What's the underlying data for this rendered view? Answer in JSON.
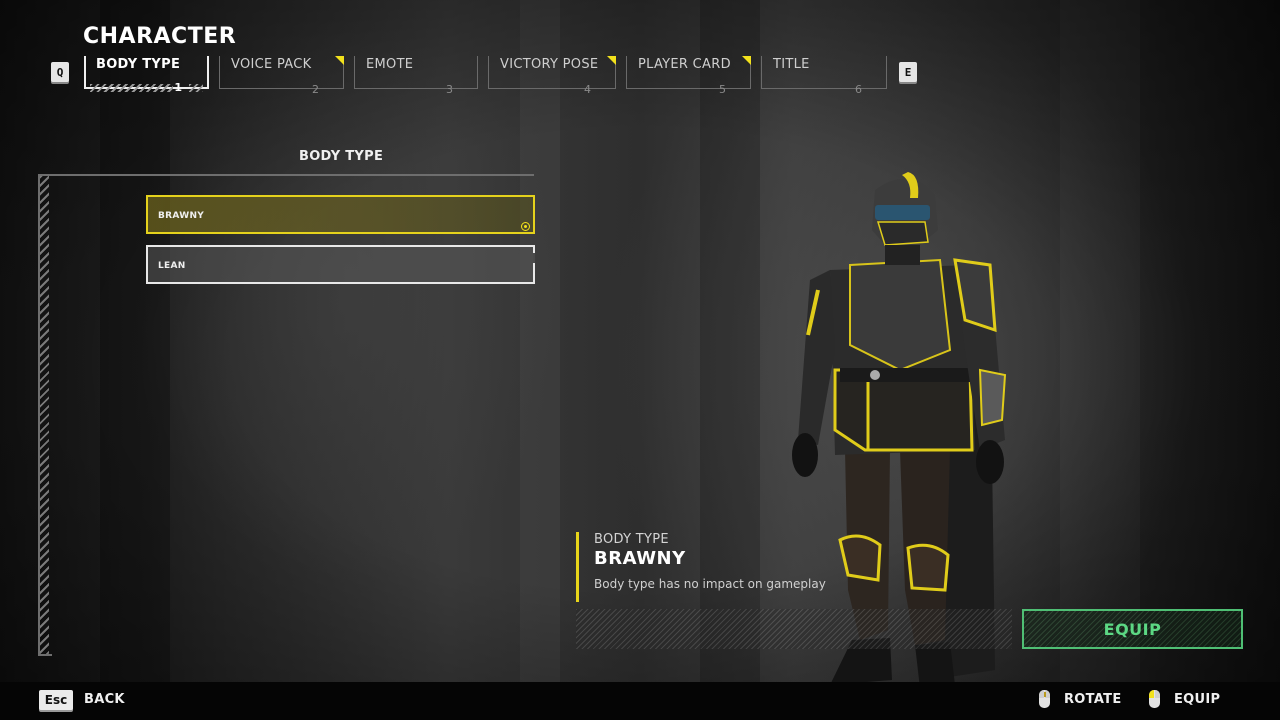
{
  "header": {
    "title": "CHARACTER",
    "prev_key": "Q",
    "next_key": "E"
  },
  "tabs": [
    {
      "label": "BODY TYPE",
      "number": "1",
      "active": true,
      "new_indicator": false
    },
    {
      "label": "VOICE PACK",
      "number": "2",
      "active": false,
      "new_indicator": true
    },
    {
      "label": "EMOTE",
      "number": "3",
      "active": false,
      "new_indicator": false
    },
    {
      "label": "VICTORY POSE",
      "number": "4",
      "active": false,
      "new_indicator": true
    },
    {
      "label": "PLAYER CARD",
      "number": "5",
      "active": false,
      "new_indicator": true
    },
    {
      "label": "TITLE",
      "number": "6",
      "active": false,
      "new_indicator": false
    }
  ],
  "panel": {
    "heading": "BODY TYPE",
    "options": [
      {
        "label": "BRAWNY",
        "selected": true,
        "equipped": true
      },
      {
        "label": "LEAN",
        "selected": false,
        "equipped": false
      }
    ]
  },
  "details": {
    "category": "BODY TYPE",
    "name": "BRAWNY",
    "description": "Body type has no impact on gameplay",
    "equip_label": "EQUIP"
  },
  "footer": {
    "back_key": "Esc",
    "back_label": "BACK",
    "rotate_label": "ROTATE",
    "equip_label": "EQUIP"
  },
  "colors": {
    "accent_yellow": "#f2e11c",
    "equip_green": "#5cd884"
  }
}
